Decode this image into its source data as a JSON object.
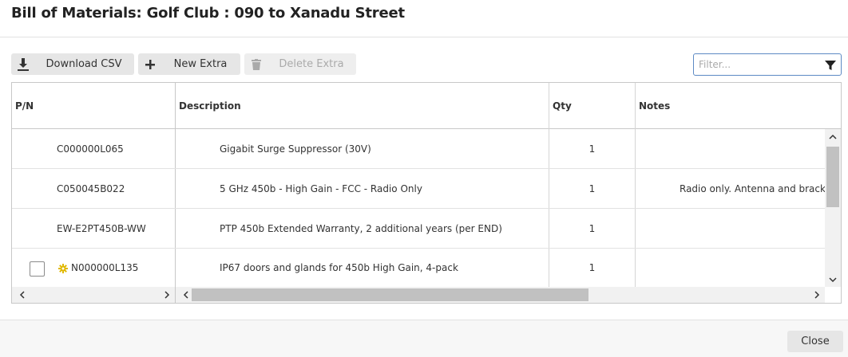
{
  "dialog": {
    "title": "Bill of Materials: Golf Club : 090 to Xanadu Street",
    "close_label": "Close"
  },
  "toolbar": {
    "download_label": "Download CSV",
    "new_extra_label": "New Extra",
    "delete_extra_label": "Delete Extra",
    "filter_placeholder": "Filter..."
  },
  "grid": {
    "columns": [
      "P/N",
      "Description",
      "Qty",
      "Notes"
    ],
    "rows": [
      {
        "pn": "C000000L065",
        "description": "Gigabit Surge Suppressor (30V)",
        "qty": "1",
        "notes": ""
      },
      {
        "pn": "C050045B022",
        "description": "5 GHz 450b - High Gain - FCC - Radio Only",
        "qty": "1",
        "notes": "Radio only. Antenna and bracke"
      },
      {
        "pn": "EW-E2PT450B-WW",
        "description": "PTP 450b Extended Warranty, 2 additional years (per END)",
        "qty": "1",
        "notes": ""
      },
      {
        "pn": "N000000L135",
        "description": "IP67 doors and glands for 450b High Gain, 4-pack",
        "qty": "1",
        "notes": "",
        "extra": true
      }
    ]
  },
  "colors": {
    "extra_icon": "#e0b800",
    "filter_border": "#5d8ac4"
  }
}
